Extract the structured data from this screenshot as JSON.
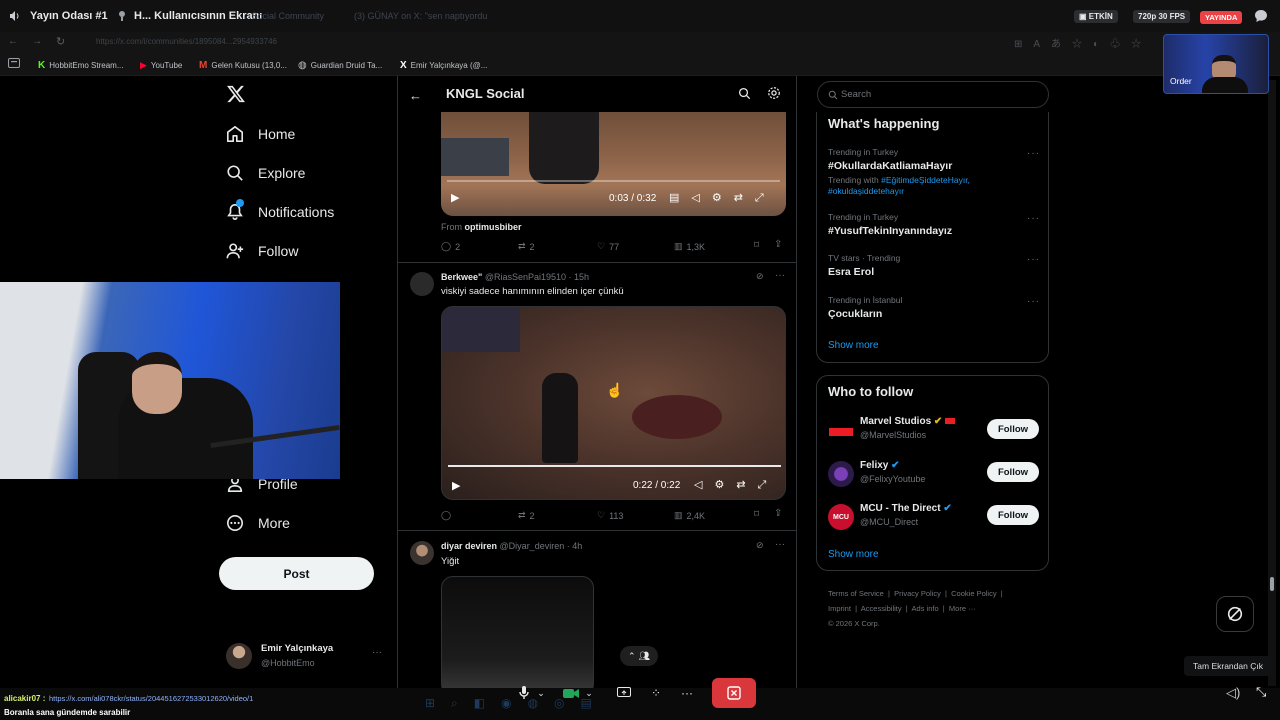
{
  "stream_bar": {
    "room_title": "Yayın Odası #1",
    "screen_title": "H... Kullanıcısının Ekranı",
    "ghost_tab1": "...Social Community",
    "ghost_tab2": "(3) GÜNAY on X: \"sen naptıyordu",
    "status_active": "ETKİN",
    "quality": "720p 30 FPS",
    "live_badge": "YAYINDA"
  },
  "browser": {
    "url": "https://x.com/i/communities/1895084...2954933746",
    "bookmarks": [
      "HobbitEmo Stream...",
      "YouTube",
      "Gelen Kutusu (13,0...",
      "Guardian Druid Ta...",
      "Emir Yalçınkaya (@..."
    ]
  },
  "overlay": {
    "cam_label": "Order",
    "exit_fullscreen_tooltip": "Tam Ekrandan Çık"
  },
  "sidebar": {
    "items": [
      {
        "label": "Home",
        "icon": "home-icon"
      },
      {
        "label": "Explore",
        "icon": "search-icon"
      },
      {
        "label": "Notifications",
        "icon": "bell-icon"
      },
      {
        "label": "Follow",
        "icon": "person-add-icon"
      },
      {
        "label": "Profile",
        "icon": "person-icon"
      },
      {
        "label": "More",
        "icon": "more-circle-icon"
      }
    ],
    "post_button": "Post",
    "account": {
      "name": "Emir Yalçınkaya",
      "handle": "@HobbitEmo"
    }
  },
  "feed": {
    "title": "KNGL Social",
    "tweet1": {
      "video_time": "0:03 / 0:32",
      "from_label": "From",
      "from_user": "optimusbiber",
      "replies": "2",
      "reposts": "2",
      "likes": "77",
      "views": "1,3K"
    },
    "tweet2": {
      "name": "Berkwee\"",
      "handle": "@RiasSenPai19510",
      "time": "15h",
      "text": "viskiyi sadece hanımının elinden içer çünkü",
      "video_time": "0:22 / 0:22",
      "replies": "",
      "reposts": "2",
      "likes": "113",
      "views": "2,4K"
    },
    "tweet3": {
      "name": "diyar deviren",
      "handle": "@Diyar_deviren",
      "time": "4h",
      "text": "Yiğit"
    }
  },
  "right": {
    "search_placeholder": "Search",
    "happening_title": "What's happening",
    "trends": [
      {
        "context": "Trending in Turkey",
        "title": "#OkullardaKatliamaHayır",
        "with_label": "Trending with",
        "with_tags": "#EğitimdeŞiddeteHayır, #okuldaşiddetehayır"
      },
      {
        "context": "Trending in Turkey",
        "title": "#YusufTekinInyanındayız"
      },
      {
        "context": "TV stars · Trending",
        "title": "Esra Erol"
      },
      {
        "context": "Trending in İstanbul",
        "title": "Çocukların"
      }
    ],
    "show_more": "Show more",
    "who_to_follow_title": "Who to follow",
    "suggestions": [
      {
        "name": "Marvel Studios",
        "handle": "@MarvelStudios",
        "button": "Follow"
      },
      {
        "name": "Felixy",
        "handle": "@FelixyYoutube",
        "button": "Follow"
      },
      {
        "name": "MCU - The Direct",
        "handle": "@MCU_Direct",
        "button": "Follow"
      }
    ],
    "footer_line1": [
      "Terms of Service",
      "Privacy Policy",
      "Cookie Policy"
    ],
    "footer_line2": [
      "Imprint",
      "Accessibility",
      "Ads info",
      "More ···"
    ],
    "copyright": "© 2026 X Corp."
  },
  "chat": {
    "user": "alicakir07 :",
    "link": "https://x.com/ali078ckr/status/2044516272533012620/video/1",
    "message": "Boranla sana gündemde sarabilir"
  },
  "colors": {
    "accent": "#1d9bf0",
    "live": "#ed4245",
    "end_call": "#da373c",
    "verified_gold": "#e2b719"
  }
}
